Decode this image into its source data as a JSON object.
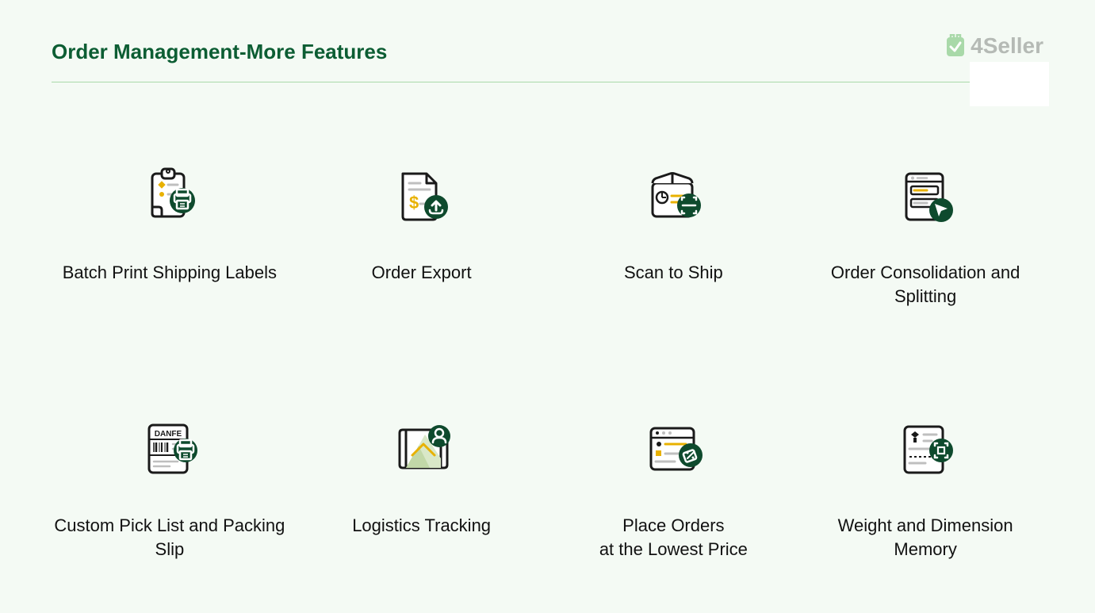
{
  "header": {
    "title": "Order Management-More Features",
    "brand": "4Seller"
  },
  "features": [
    {
      "label": "Batch Print Shipping Labels"
    },
    {
      "label": "Order Export"
    },
    {
      "label": "Scan to Ship"
    },
    {
      "label": "Order Consolidation and Splitting"
    },
    {
      "label": "Custom Pick List and Packing Slip"
    },
    {
      "label": "Logistics Tracking"
    },
    {
      "label": "Place Orders\nat the Lowest Price"
    },
    {
      "label": "Weight and Dimension Memory"
    }
  ]
}
